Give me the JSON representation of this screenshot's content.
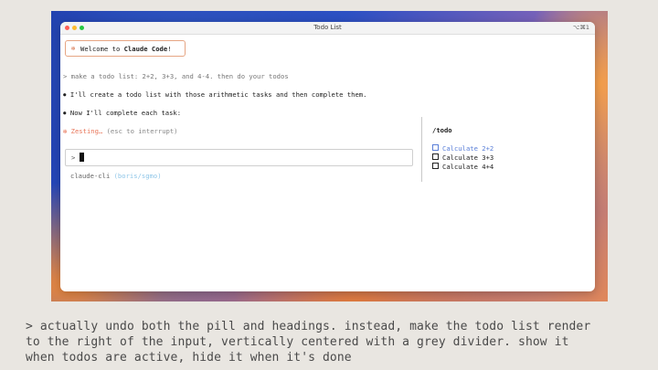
{
  "window": {
    "title": "Todo List",
    "shortcut": "⌥⌘1"
  },
  "welcome": {
    "star": "✻",
    "prefix": "Welcome to ",
    "app_name": "Claude Code",
    "suffix": "!"
  },
  "transcript": {
    "user_prompt": "> make a todo list: 2+2, 3+3, and 4-4. then do your todos",
    "bullet_1": "⏺ I'll create a todo list with those arithmetic tasks and then complete them.",
    "bullet_2": "⏺ Now I'll complete each task:",
    "status_star": "✻",
    "status_text": "Zesting…",
    "status_hint": "(esc to interrupt)"
  },
  "input": {
    "caret": ">",
    "value": ""
  },
  "cli": {
    "name": "claude-cli",
    "branch": "(boris/sgmo)"
  },
  "todo": {
    "title": "/todo",
    "items": [
      {
        "label": "Calculate 2+2",
        "state": "active"
      },
      {
        "label": "Calculate 3+3",
        "state": "pending"
      },
      {
        "label": "Calculate 4+4",
        "state": "pending"
      }
    ]
  },
  "caption": "> actually undo both the pill and headings. instead, make the todo list render\nto the right of the input, vertically centered with a grey divider. show it\nwhen todos are active, hide it when it's done",
  "colors": {
    "accent_orange": "#e8765a",
    "todo_active_blue": "#5a7fd8",
    "branch_blue": "#8fc6e8"
  }
}
